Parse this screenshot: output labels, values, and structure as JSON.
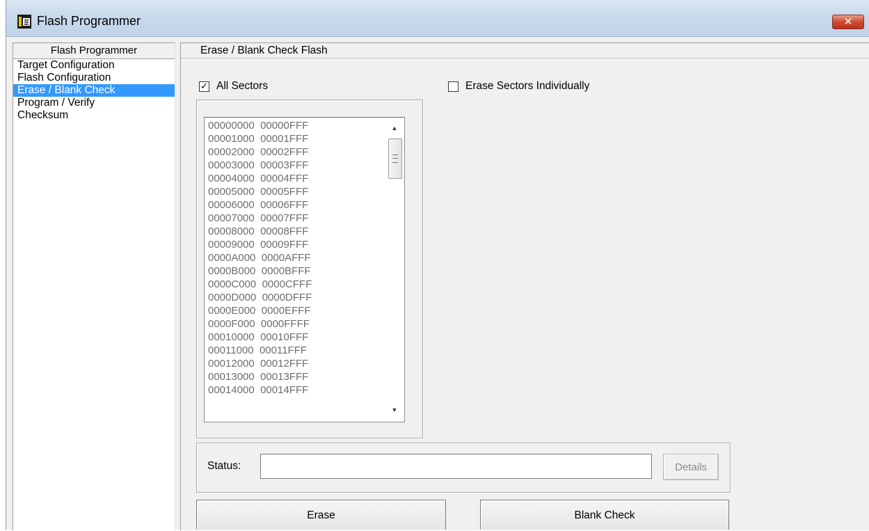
{
  "window": {
    "title": "Flash Programmer",
    "close_label": "✕"
  },
  "nav": {
    "header": "Flash Programmer",
    "items": [
      {
        "label": "Target Configuration"
      },
      {
        "label": "Flash Configuration"
      },
      {
        "label": "Erase / Blank Check",
        "selected": true
      },
      {
        "label": "Program / Verify"
      },
      {
        "label": "Checksum"
      }
    ]
  },
  "panel": {
    "header": "Erase / Blank Check Flash",
    "all_sectors": {
      "label": "All Sectors",
      "checked": true
    },
    "erase_individually": {
      "label": "Erase Sectors Individually",
      "checked": false
    },
    "sectors": [
      "00000000  00000FFF",
      "00001000  00001FFF",
      "00002000  00002FFF",
      "00003000  00003FFF",
      "00004000  00004FFF",
      "00005000  00005FFF",
      "00006000  00006FFF",
      "00007000  00007FFF",
      "00008000  00008FFF",
      "00009000  00009FFF",
      "0000A000  0000AFFF",
      "0000B000  0000BFFF",
      "0000C000  0000CFFF",
      "0000D000  0000DFFF",
      "0000E000  0000EFFF",
      "0000F000  0000FFFF",
      "00010000  00010FFF",
      "00011000  00011FFF",
      "00012000  00012FFF",
      "00013000  00013FFF",
      "00014000  00014FFF"
    ],
    "status": {
      "label": "Status:",
      "value": ""
    },
    "details_label": "Details",
    "erase_label": "Erase",
    "blank_check_label": "Blank Check"
  },
  "colors": {
    "selection": "#3399ff",
    "close_button": "#cf4d32",
    "disabled_text": "#8c8c8c"
  }
}
